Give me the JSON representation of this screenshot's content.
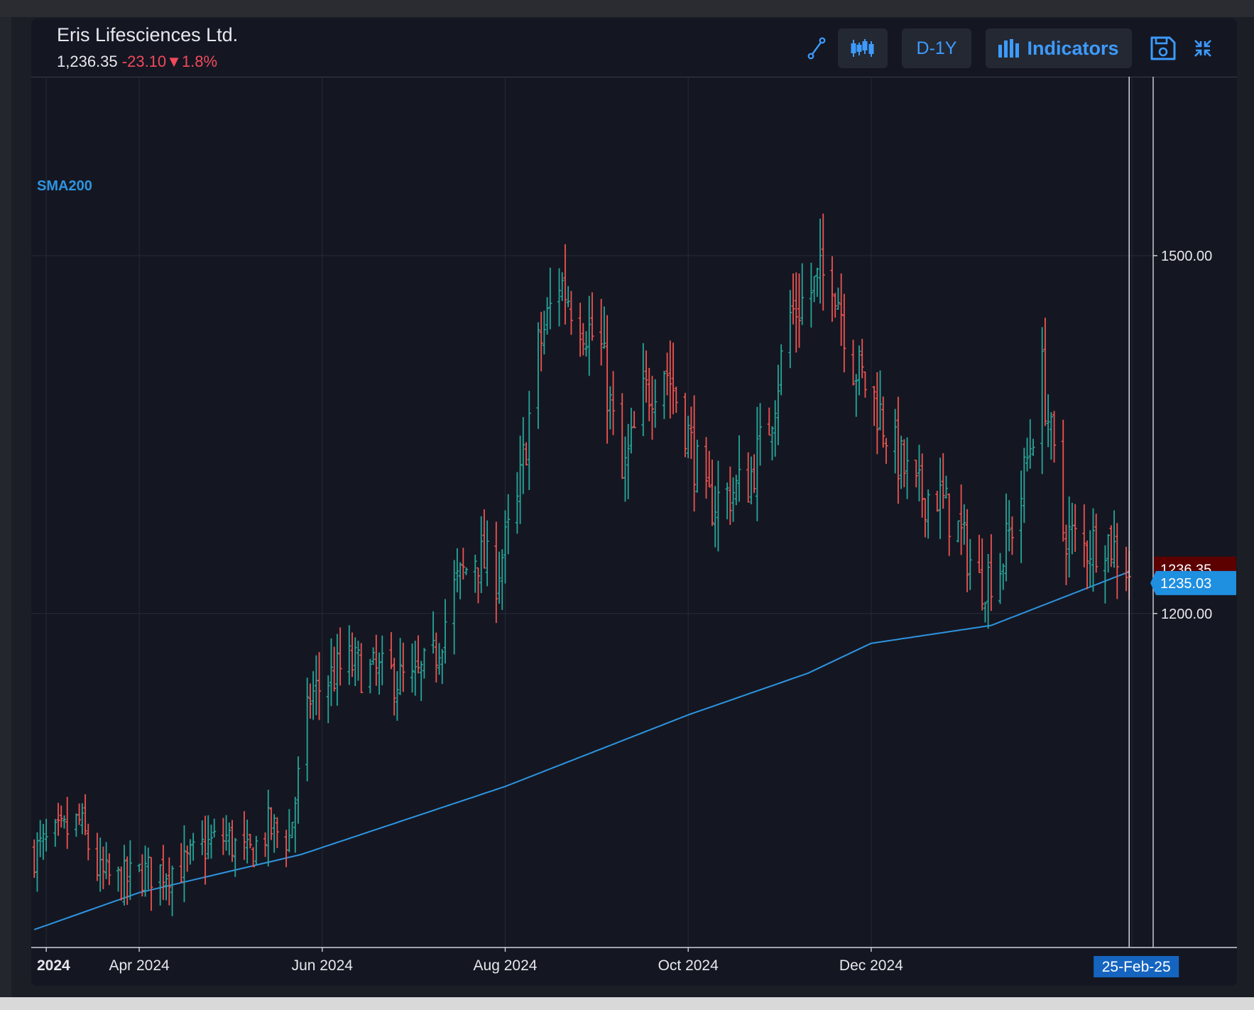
{
  "header": {
    "name": "Eris Lifesciences Ltd.",
    "last_price": "1,236.35",
    "change": "-23.10",
    "change_arrow": "▼",
    "change_pct": "1.8%",
    "range_label": "D-1Y",
    "indicators_label": "Indicators",
    "icons": [
      "draw-line-icon",
      "candlestick-icon",
      "bar-chart-icon",
      "save-icon",
      "collapse-icon"
    ]
  },
  "colors": {
    "up": "#26a69a",
    "down": "#ef5350",
    "sma": "#2e94e0",
    "accent": "#3d9bff",
    "last_label_bg": "#5c0000",
    "sma_label_bg": "#1f8fe0"
  },
  "chart_data": {
    "type": "ohlc",
    "symbol": "Eris Lifesciences Ltd.",
    "interval": "D-1Y",
    "indicator": "SMA200",
    "ylim": [
      920,
      1650
    ],
    "yticks": [
      1200,
      1500
    ],
    "ytick_labels": [
      "1200.00",
      "1500.00"
    ],
    "x_range": [
      "2024-02-25",
      "2025-03-05"
    ],
    "xticks": [
      {
        "date": "2024-03-01",
        "label": "2024"
      },
      {
        "date": "2024-04-01",
        "label": "Apr 2024"
      },
      {
        "date": "2024-06-01",
        "label": "Jun 2024"
      },
      {
        "date": "2024-08-01",
        "label": "Aug 2024"
      },
      {
        "date": "2024-10-01",
        "label": "Oct 2024"
      },
      {
        "date": "2024-12-01",
        "label": "Dec 2024"
      }
    ],
    "crosshair_date_label": "25-Feb-25",
    "crosshair_date": "2025-02-25",
    "last_price": 1236.35,
    "last_price_label": "1236.35",
    "sma_last": 1235.03,
    "sma_last_label": "1235.03",
    "grid": true,
    "price_anchors": [
      [
        "2024-02-26",
        1000
      ],
      [
        "2024-03-05",
        1012
      ],
      [
        "2024-03-12",
        1025
      ],
      [
        "2024-03-19",
        980
      ],
      [
        "2024-03-26",
        975
      ],
      [
        "2024-04-02",
        982
      ],
      [
        "2024-04-09",
        985
      ],
      [
        "2024-04-16",
        988
      ],
      [
        "2024-04-23",
        1005
      ],
      [
        "2024-04-30",
        1012
      ],
      [
        "2024-05-07",
        995
      ],
      [
        "2024-05-14",
        1020
      ],
      [
        "2024-05-21",
        1012
      ],
      [
        "2024-05-24",
        1060
      ],
      [
        "2024-05-28",
        1130
      ],
      [
        "2024-06-03",
        1145
      ],
      [
        "2024-06-10",
        1158
      ],
      [
        "2024-06-17",
        1150
      ],
      [
        "2024-06-24",
        1148
      ],
      [
        "2024-07-01",
        1140
      ],
      [
        "2024-07-08",
        1160
      ],
      [
        "2024-07-15",
        1220
      ],
      [
        "2024-07-22",
        1250
      ],
      [
        "2024-07-29",
        1232
      ],
      [
        "2024-08-05",
        1290
      ],
      [
        "2024-08-12",
        1420
      ],
      [
        "2024-08-19",
        1480
      ],
      [
        "2024-08-26",
        1450
      ],
      [
        "2024-09-02",
        1420
      ],
      [
        "2024-09-09",
        1310
      ],
      [
        "2024-09-16",
        1380
      ],
      [
        "2024-09-23",
        1410
      ],
      [
        "2024-09-30",
        1360
      ],
      [
        "2024-10-07",
        1290
      ],
      [
        "2024-10-14",
        1300
      ],
      [
        "2024-10-21",
        1310
      ],
      [
        "2024-10-28",
        1360
      ],
      [
        "2024-11-04",
        1450
      ],
      [
        "2024-11-11",
        1470
      ],
      [
        "2024-11-18",
        1490
      ],
      [
        "2024-11-25",
        1410
      ],
      [
        "2024-12-02",
        1380
      ],
      [
        "2024-12-09",
        1335
      ],
      [
        "2024-12-16",
        1300
      ],
      [
        "2024-12-23",
        1300
      ],
      [
        "2024-12-30",
        1270
      ],
      [
        "2025-01-06",
        1225
      ],
      [
        "2025-01-13",
        1240
      ],
      [
        "2025-01-20",
        1300
      ],
      [
        "2025-01-27",
        1400
      ],
      [
        "2025-02-03",
        1270
      ],
      [
        "2025-02-10",
        1255
      ],
      [
        "2025-02-17",
        1265
      ],
      [
        "2025-02-25",
        1236.35
      ]
    ],
    "sma_anchors": [
      [
        "2024-02-26",
        935
      ],
      [
        "2024-04-01",
        966
      ],
      [
        "2024-05-25",
        998
      ],
      [
        "2024-08-01",
        1055
      ],
      [
        "2024-10-01",
        1115
      ],
      [
        "2024-11-10",
        1150
      ],
      [
        "2024-12-01",
        1175
      ],
      [
        "2025-01-10",
        1190
      ],
      [
        "2025-02-25",
        1235.03
      ]
    ]
  }
}
